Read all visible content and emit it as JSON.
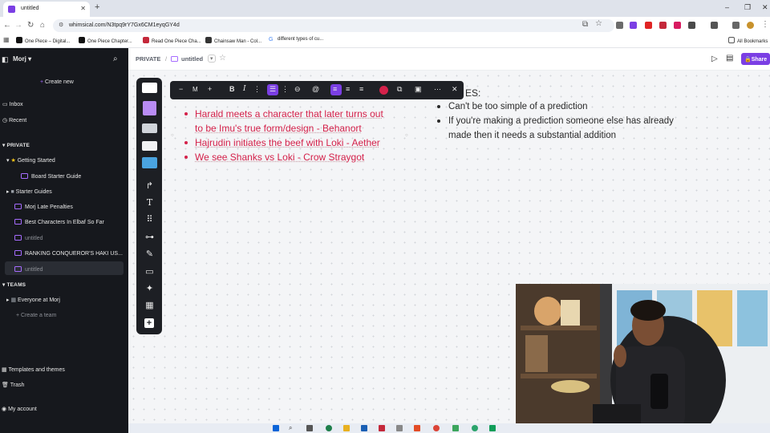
{
  "browser": {
    "tab_title": "untitled",
    "new_tab": "+",
    "url": "whimsical.com/N3tpq9rY7Gx6CM1eyqGY4d",
    "bookmarks": [
      "One Piece – Digital...",
      "One Piece Chapter...",
      "Read One Piece Cha...",
      "Chainsaw Man - Col...",
      "different types of cu..."
    ],
    "all_bookmarks": "All Bookmarks",
    "window_controls": [
      "–",
      "❐",
      "✕"
    ]
  },
  "sidebar": {
    "workspace": "Morj",
    "create_new": "Create new",
    "inbox": "Inbox",
    "recent": "Recent",
    "private_header": "PRIVATE",
    "private_items": [
      {
        "label": "Getting Started"
      },
      {
        "label": "Board Starter Guide"
      },
      {
        "label": "Starter Guides"
      },
      {
        "label": "Morj Late Penalties"
      },
      {
        "label": "Best Characters In Elbaf So Far"
      },
      {
        "label": "untitled"
      },
      {
        "label": "RANKING CONQUEROR'S HAKI US..."
      },
      {
        "label": "untitled"
      }
    ],
    "teams_header": "TEAMS",
    "team_items": [
      "Everyone at Morj"
    ],
    "create_team": "Create a team",
    "templates": "Templates and themes",
    "trash": "Trash",
    "account": "My account"
  },
  "topbar": {
    "breadcrumb_root": "PRIVATE",
    "separator": "/",
    "doc_title": "untitled",
    "share_label": "Share"
  },
  "format_toolbar": {
    "size_minus": "−",
    "size_value": "M",
    "size_plus": "+",
    "bold": "B",
    "italic": "I"
  },
  "canvas": {
    "predictions": [
      {
        "line1": "Harald meets a character that later turns out",
        "line2": "to be Imu's true form/design - Behanort"
      },
      {
        "line1": "Hajrudin initiates the beef with Loki - Aether"
      },
      {
        "line1": "We see Shanks vs Loki - Crow Straygot"
      }
    ],
    "rules_header_fragment": "ES:",
    "rules": [
      {
        "line1": "Can't be too simple of a prediction"
      },
      {
        "line1": "If you're making a prediction someone else has already",
        "line2": "made then it needs a substantial addition"
      }
    ]
  },
  "colors": {
    "accent": "#7b3fe4",
    "prediction_text": "#d4214a",
    "sidebar_bg": "#16181d"
  }
}
